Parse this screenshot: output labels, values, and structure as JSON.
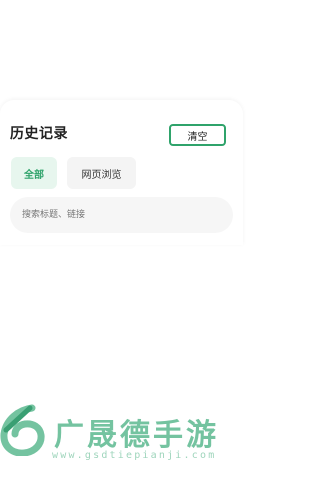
{
  "history": {
    "title": "历史记录",
    "clear_label": "清空",
    "tabs": [
      {
        "label": "全部",
        "active": true
      },
      {
        "label": "网页浏览",
        "active": false
      }
    ],
    "search": {
      "placeholder": "搜索标题、链接",
      "value": ""
    }
  },
  "watermark": {
    "brand": "广晟德手游",
    "url": "www.gsdtiepianji.com"
  },
  "colors": {
    "accent": "#2fa36b",
    "active_tab_bg": "#e7f6ee",
    "inactive_tab_bg": "#f4f4f4",
    "search_bg": "#f6f6f6",
    "watermark": "#74c3a0"
  }
}
